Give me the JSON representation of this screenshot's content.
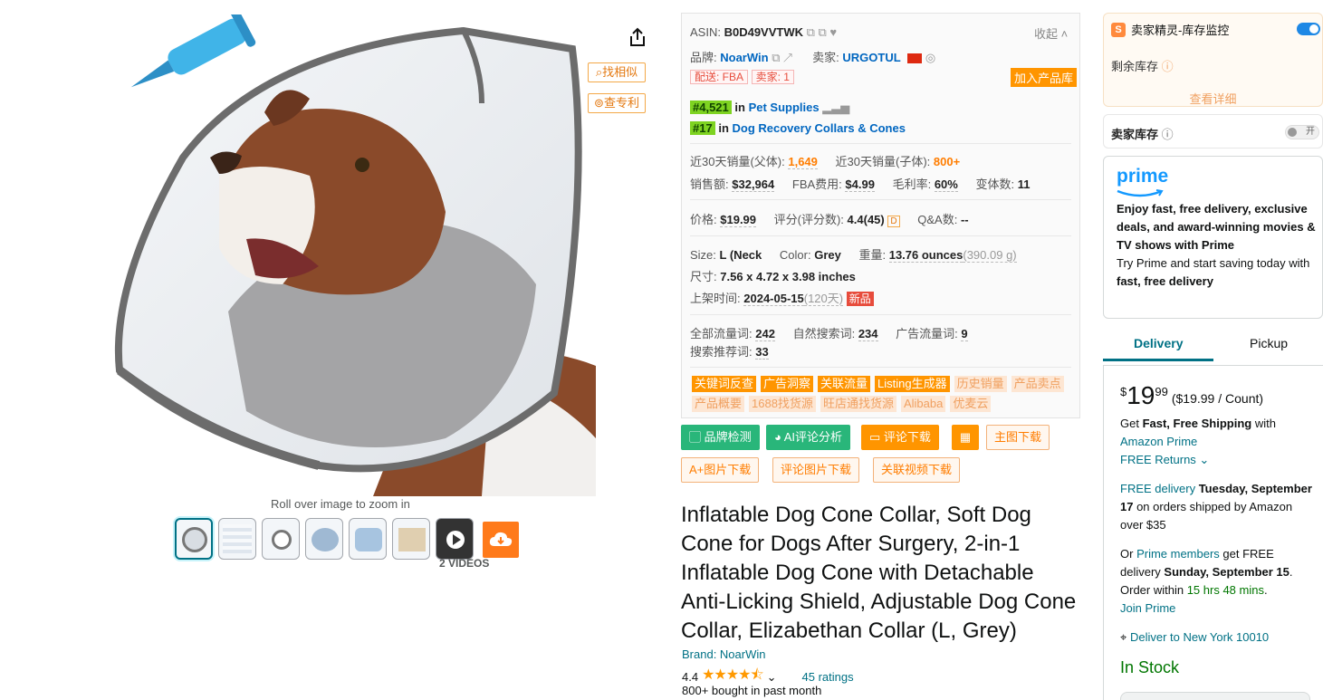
{
  "image_area": {
    "find_similar_label": "找相似",
    "check_patent_label": "查专利",
    "zoom_hint": "Roll over image to zoom in",
    "videos_label": "2 VIDEOS"
  },
  "panel": {
    "asin_label": "ASIN:",
    "asin": "B0D49VVTWK",
    "collapse": "收起",
    "brand_label": "品牌:",
    "brand": "NoarWin",
    "seller_label": "卖家:",
    "seller": "URGOTUL",
    "ship_tag": "配送: FBA",
    "seller_count_tag": "卖家: 1",
    "add_library": "加入产品库",
    "rank1": "#4,521",
    "rank1_in": "in",
    "rank1_cat": "Pet Supplies",
    "rank2": "#17",
    "rank2_in": "in",
    "rank2_cat": "Dog Recovery Collars & Cones",
    "sales30_parent_label": "近30天销量(父体):",
    "sales30_parent": "1,649",
    "sales30_child_label": "近30天销量(子体):",
    "sales30_child": "800+",
    "revenue_label": "销售额:",
    "revenue": "$32,964",
    "fba_label": "FBA费用:",
    "fba": "$4.99",
    "margin_label": "毛利率:",
    "margin": "60%",
    "variants_label": "变体数:",
    "variants": "11",
    "price_label": "价格:",
    "price": "$19.99",
    "rating_label": "评分(评分数):",
    "rating": "4.4(45)",
    "rating_d": "D",
    "qa_label": "Q&A数:",
    "qa": "--",
    "size_label": "Size:",
    "size": "L (Neck",
    "color_label": "Color:",
    "color": "Grey",
    "weight_label": "重量:",
    "weight": "13.76 ounces",
    "weight_g": "(390.09 g)",
    "dim_label": "尺寸:",
    "dim": "7.56 x 4.72 x 3.98 inches",
    "listed_label": "上架时间:",
    "listed": "2024-05-15",
    "listed_days": "(120天)",
    "new_badge": "新品",
    "traffic_all_label": "全部流量词:",
    "traffic_all": "242",
    "organic_label": "自然搜索词:",
    "organic": "234",
    "ad_label": "广告流量词:",
    "ad": "9",
    "recommend_label": "搜索推荐词:",
    "recommend": "33",
    "tool_tags": [
      {
        "label": "关键词反查",
        "style": "solid"
      },
      {
        "label": "广告洞察",
        "style": "solid"
      },
      {
        "label": "关联流量",
        "style": "solid"
      },
      {
        "label": "Listing生成器",
        "style": "solid"
      },
      {
        "label": "历史销量",
        "style": "light"
      },
      {
        "label": "产品卖点",
        "style": "light"
      },
      {
        "label": "产品概要",
        "style": "light"
      },
      {
        "label": "1688找货源",
        "style": "light"
      },
      {
        "label": "旺店通找货源",
        "style": "light"
      },
      {
        "label": "Alibaba",
        "style": "light"
      },
      {
        "label": "优麦云",
        "style": "light"
      }
    ]
  },
  "actions": {
    "brand_check": "品牌检测",
    "ai_review": "AI评论分析",
    "review_download": "评论下载",
    "main_image_download": "主图下载",
    "aplus_download": "A+图片下载",
    "review_image_download": "评论图片下载",
    "video_download": "关联视频下载"
  },
  "product": {
    "title": "Inflatable Dog Cone Collar, Soft Dog Cone for Dogs After Surgery, 2-in-1 Inflatable Dog Cone with Detachable Anti-Licking Shield, Adjustable Dog Cone Collar, Elizabethan Collar (L, Grey)",
    "brand_line": "Brand: NoarWin",
    "rating_value": "4.4",
    "rating_stars": 4.4,
    "stars_text": "★★★★⯪",
    "ratings_count": "45 ratings",
    "bought": "800+ bought in past month"
  },
  "monitor": {
    "title": "卖家精灵-库存监控",
    "remaining_label": "剩余库存",
    "view_detail": "查看详细"
  },
  "seller_stock": {
    "label": "卖家库存",
    "toggle": "开"
  },
  "prime": {
    "logo": "prime",
    "headline": "Enjoy fast, free delivery, exclusive deals, and award-winning movies & TV shows with Prime",
    "sub1": "Try Prime and start saving today with ",
    "sub2": "fast, free delivery"
  },
  "tabs": {
    "delivery": "Delivery",
    "pickup": "Pickup"
  },
  "buybox": {
    "currency": "$",
    "whole": "19",
    "fraction": "99",
    "unit_price": "($19.99 / Count)",
    "ship1": "Get ",
    "ship_bold": "Fast, Free Shipping",
    "ship2": " with",
    "amazon_prime": "Amazon Prime",
    "free_returns": "FREE Returns",
    "free_delivery": "FREE delivery",
    "delivery_date": "Tuesday, September 17",
    "delivery_rest": " on orders shipped by Amazon over $35",
    "or": "Or ",
    "prime_members": "Prime members",
    "get_free": " get FREE delivery ",
    "fast_date": "Sunday, September 15",
    "order_within": ". Order within ",
    "countdown": "15 hrs 48 mins",
    "join_prime": "Join Prime",
    "deliver_to": "Deliver to New York 10010",
    "in_stock": "In Stock"
  }
}
